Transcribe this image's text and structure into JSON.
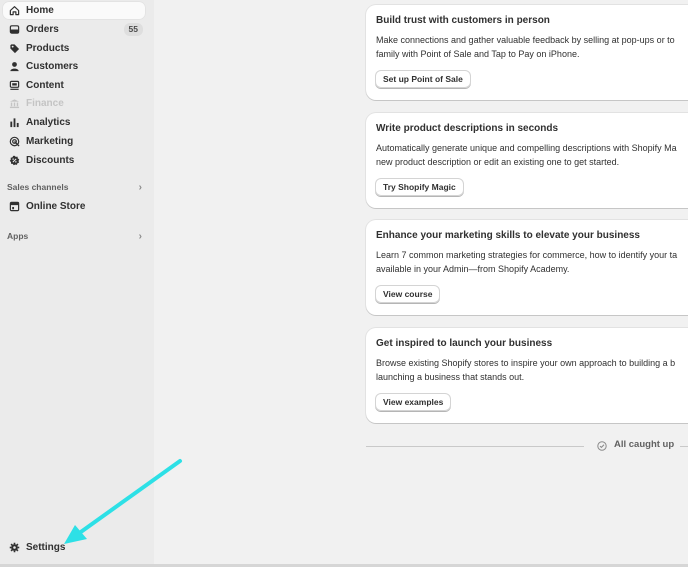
{
  "sidebar": {
    "nav": [
      {
        "label": "Home",
        "icon": "home-icon",
        "active": true
      },
      {
        "label": "Orders",
        "icon": "orders-icon",
        "badge": "55"
      },
      {
        "label": "Products",
        "icon": "tag-icon"
      },
      {
        "label": "Customers",
        "icon": "person-icon"
      },
      {
        "label": "Content",
        "icon": "content-icon"
      },
      {
        "label": "Finance",
        "icon": "bank-icon",
        "disabled": true
      },
      {
        "label": "Analytics",
        "icon": "bar-chart-icon"
      },
      {
        "label": "Marketing",
        "icon": "target-icon"
      },
      {
        "label": "Discounts",
        "icon": "discount-icon"
      }
    ],
    "sales_channels": {
      "label": "Sales channels",
      "items": [
        {
          "label": "Online Store",
          "icon": "store-icon"
        }
      ]
    },
    "apps": {
      "label": "Apps"
    },
    "settings": {
      "label": "Settings",
      "icon": "gear-icon"
    }
  },
  "cards": [
    {
      "title": "Build trust with customers in person",
      "body_line1": "Make connections and gather valuable feedback by selling at pop-ups or to",
      "body_line2": "family with Point of Sale and Tap to Pay on iPhone.",
      "button": "Set up Point of Sale"
    },
    {
      "title": "Write product descriptions in seconds",
      "body_line1": "Automatically generate unique and compelling descriptions with Shopify Ma",
      "body_line2": "new product description or edit an existing one to get started.",
      "button": "Try Shopify Magic"
    },
    {
      "title": "Enhance your marketing skills to elevate your business",
      "body_line1": "Learn 7 common marketing strategies for commerce, how to identify your ta",
      "body_line2": "available in your Admin—from Shopify Academy.",
      "button": "View course"
    },
    {
      "title": "Get inspired to launch your business",
      "body_line1": "Browse existing Shopify stores to inspire your own approach to building a b",
      "body_line2": "launching a business that stands out.",
      "button": "View examples"
    }
  ],
  "caught_up": "All caught up",
  "colors": {
    "sidebar_bg": "#ebebeb",
    "page_bg": "#f1f1f1",
    "arrow": "#2de0e6"
  }
}
